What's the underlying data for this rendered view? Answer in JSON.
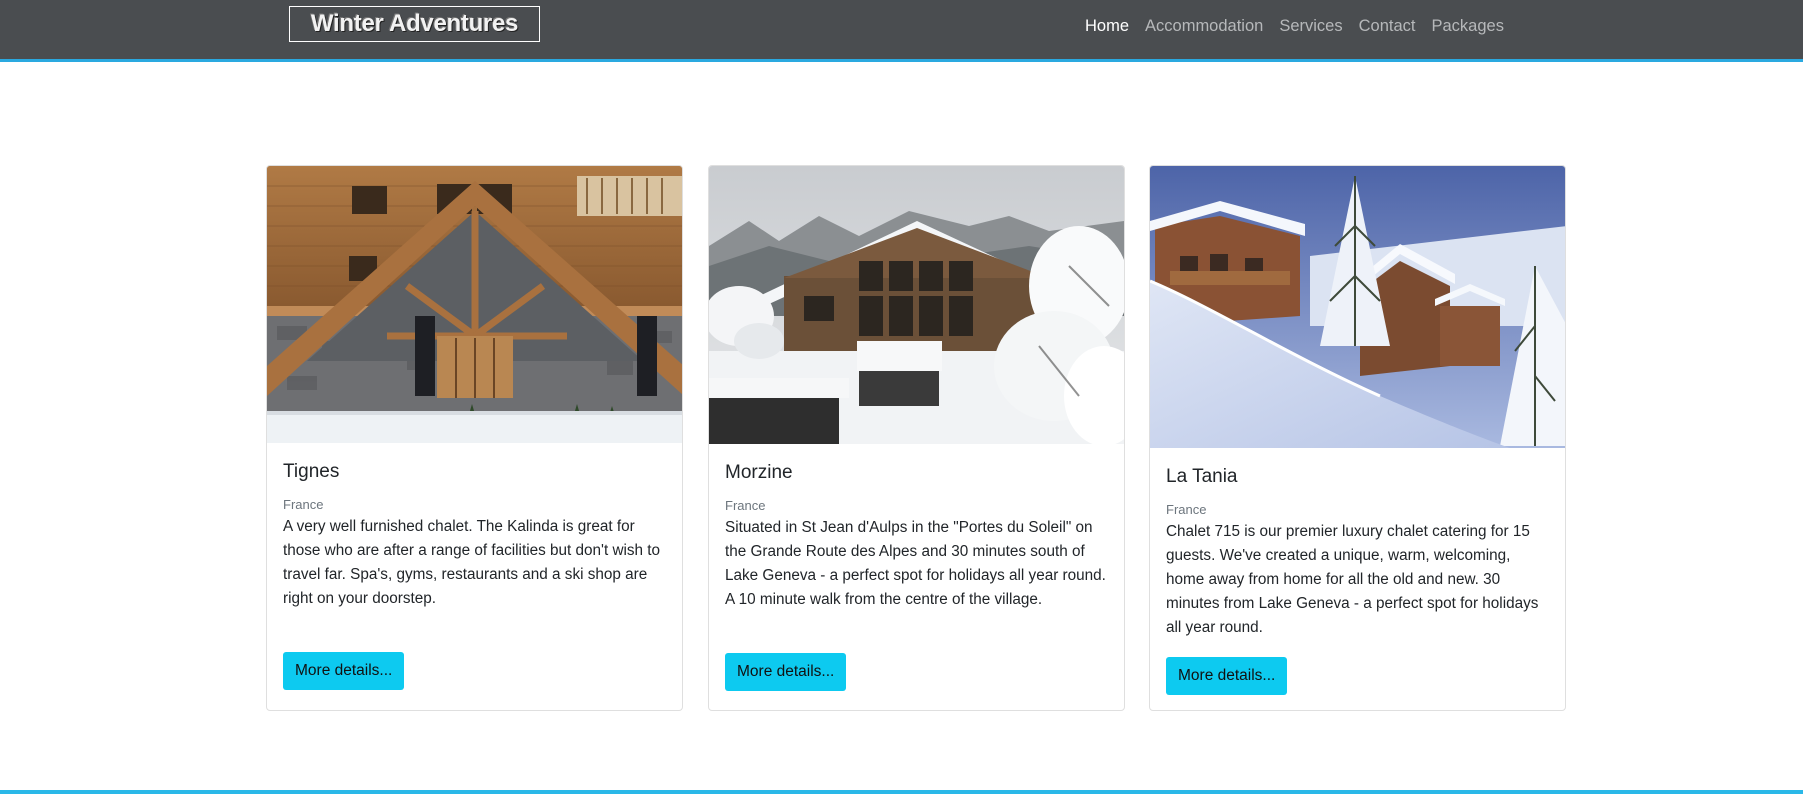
{
  "brand": "Winter Adventures",
  "nav": {
    "items": [
      "Home",
      "Accommodation",
      "Services",
      "Contact",
      "Packages"
    ],
    "active": "Home"
  },
  "cards": [
    {
      "title": "Tignes",
      "subtitle": "France",
      "text": "A very well furnished chalet. The Kalinda is great for those who are after a range of facilities but don't wish to travel far. Spa's, gyms, restaurants and a ski shop are right on your doorstep.",
      "button": "More details..."
    },
    {
      "title": "Morzine",
      "subtitle": "France",
      "text": "Situated in St Jean d'Aulps in the \"Portes du Soleil\" on the Grande Route des Alpes and 30 minutes south of Lake Geneva - a perfect spot for holidays all year round. A 10 minute walk from the centre of the village.",
      "button": "More details..."
    },
    {
      "title": "La Tania",
      "subtitle": "France",
      "text": "Chalet 715 is our premier luxury chalet catering for 15 guests. We've created a unique, warm, welcoming, home away from home for all the old and new. 30 minutes from Lake Geneva - a perfect spot for holidays all year round.",
      "button": "More details..."
    }
  ],
  "colors": {
    "navbar": "#4a4d50",
    "accent": "#2aa9e0",
    "button": "#0dcaf0"
  }
}
